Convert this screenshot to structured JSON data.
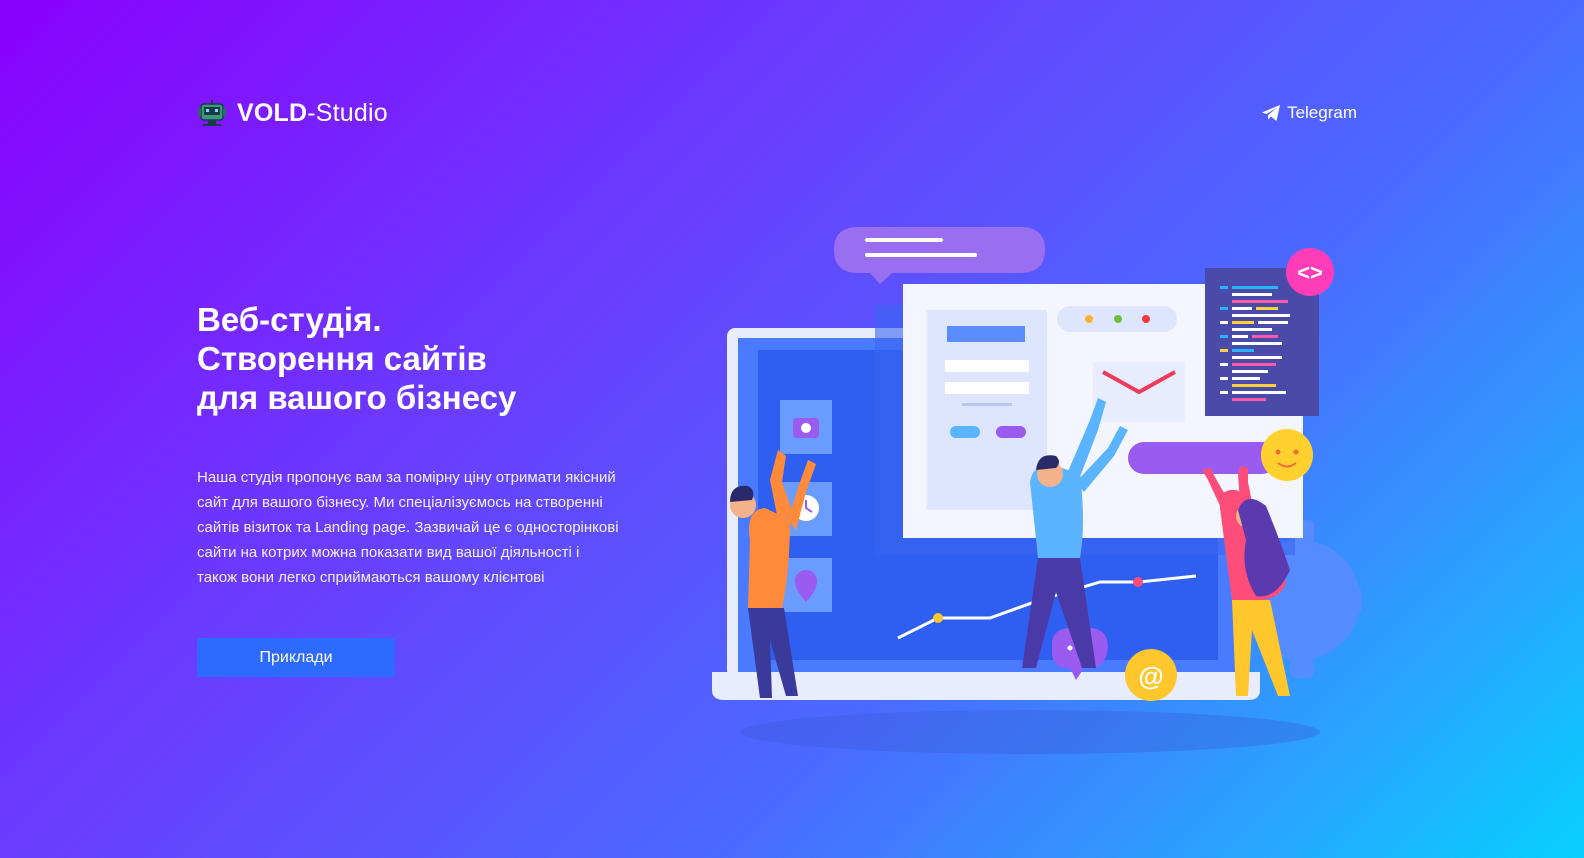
{
  "header": {
    "brand_bold": "VOLD",
    "brand_rest": "-Studio",
    "nav_telegram": "Telegram"
  },
  "hero": {
    "title_lines": [
      "Веб-студія.",
      "Створення сайтів",
      "для вашого бізнесу"
    ],
    "description_lines": [
      "Наша студія пропонує вам за помірну ціну отримати якісний",
      "сайт для вашого бізнесу. Ми спеціалізуємось на створенні",
      "сайтів візиток та Landing page. Зазвичай це є односторінкові",
      "сайти на котрих можна показати вид вашої діяльності і",
      "також вони легко сприймаються вашому клієнтові"
    ],
    "cta_label": "Приклади"
  },
  "illustration": {
    "code_badge": "<>",
    "at_badge": "@"
  },
  "colors": {
    "bg_start": "#8a00ff",
    "bg_end": "#07d0ff",
    "button": "#2d6bff",
    "accent_pink": "#ff3db8",
    "accent_yellow": "#ffc72c",
    "accent_purple": "#9a5cf0"
  },
  "icons": [
    "robot-logo-icon",
    "telegram-icon"
  ]
}
